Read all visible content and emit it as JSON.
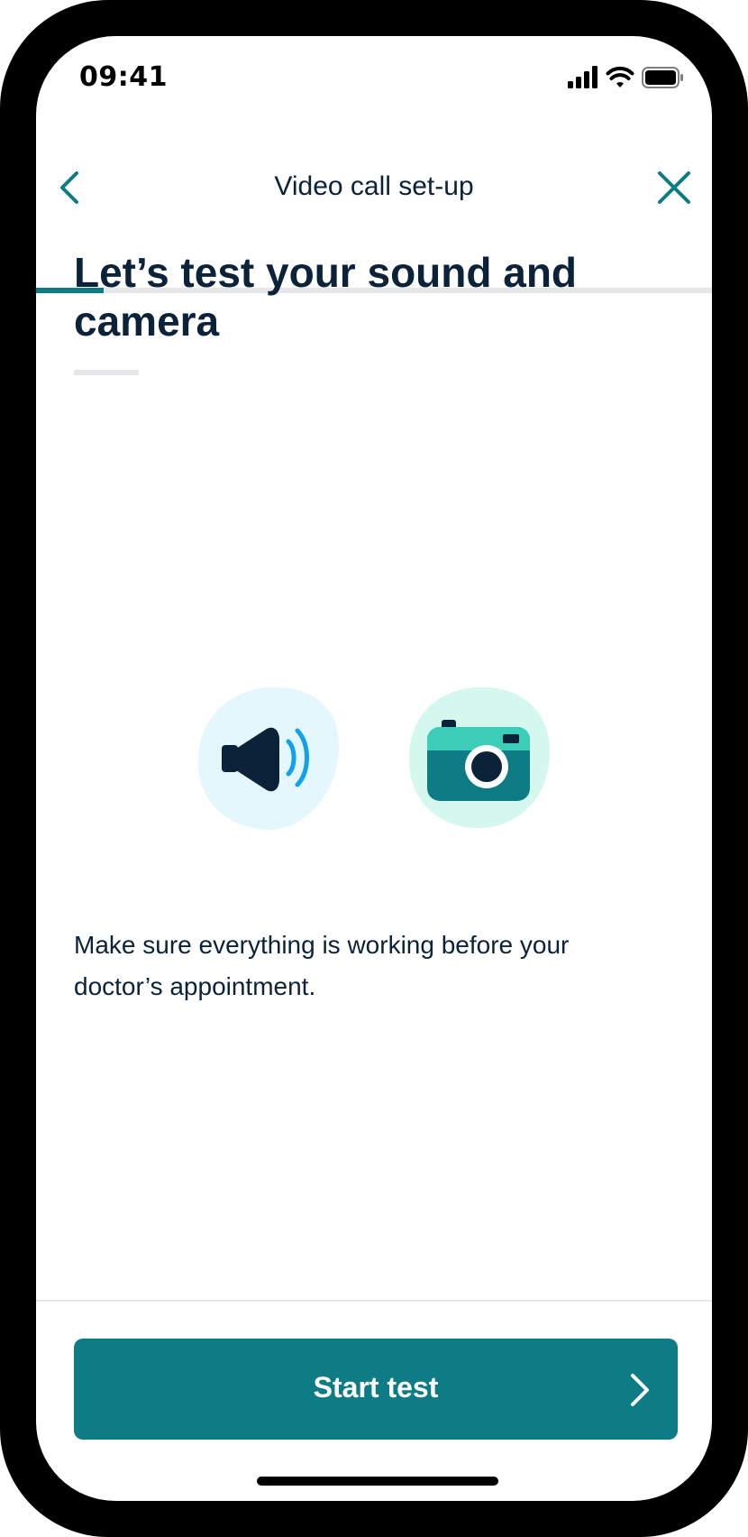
{
  "status_bar": {
    "time": "09:41"
  },
  "nav": {
    "title": "Video call set-up",
    "back_icon": "chevron-left-icon",
    "close_icon": "close-icon",
    "progress": 0.1
  },
  "content": {
    "heading": "Let’s test your sound and camera",
    "illustrations": [
      "speaker-icon",
      "camera-icon"
    ],
    "body": "Make sure everything is working before your doctor’s appointment."
  },
  "cta": {
    "label": "Start test",
    "icon": "chevron-right-icon"
  },
  "colors": {
    "brand_teal": "#0e7c85",
    "heading_navy": "#0b2239",
    "speaker_bg": "#e4f7fc",
    "camera_bg": "#d4f7ee",
    "accent_blue": "#13a1ea"
  }
}
